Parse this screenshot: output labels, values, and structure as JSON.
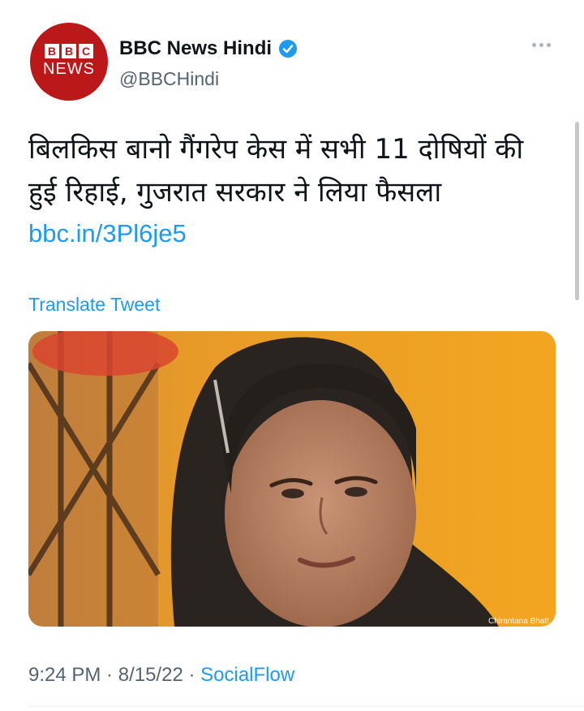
{
  "account": {
    "avatar_top": [
      "B",
      "B",
      "C"
    ],
    "avatar_bottom": "NEWS",
    "display_name": "BBC News Hindi",
    "handle": "@BBCHindi",
    "verified": true
  },
  "tweet": {
    "text": "बिलकिस बानो गैंगरेप केस में सभी 11 दोषियों की हुई रिहाई, गुजरात सरकार ने लिया फैसला",
    "link": "bbc.in/3Pl6je5",
    "translate_label": "Translate Tweet",
    "photo_credit": "Chirantana Bhatt"
  },
  "meta": {
    "time": "9:24 PM",
    "separator": " · ",
    "date": "8/15/22",
    "source": "SocialFlow"
  },
  "colors": {
    "brand_red": "#bb1919",
    "link_blue": "#1d9bf0",
    "text": "#0f1419",
    "muted": "#536471"
  },
  "icons": [
    "verified-badge-icon",
    "more-options-icon"
  ]
}
